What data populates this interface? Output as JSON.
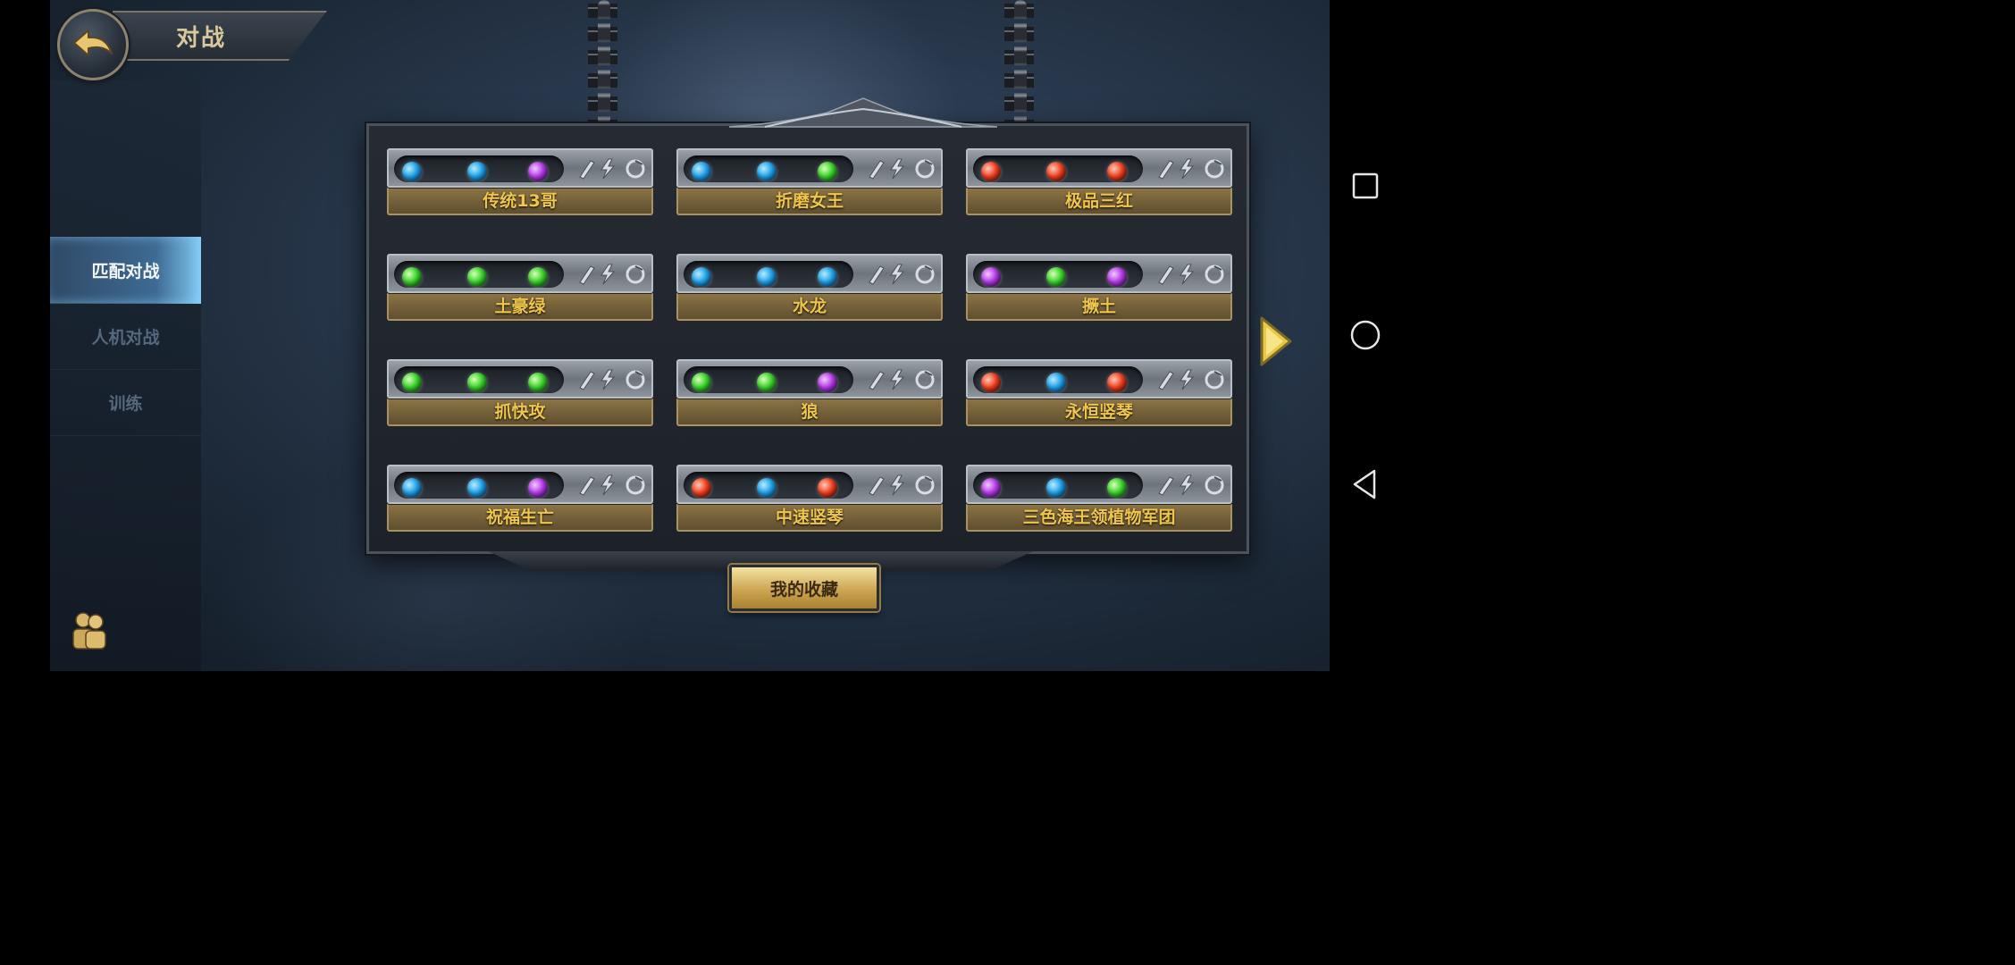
{
  "header": {
    "title": "对战",
    "back_icon": "back-arrow-icon"
  },
  "side_menu": {
    "items": [
      {
        "label": "匹配对战",
        "active": true
      },
      {
        "label": "人机对战",
        "active": false
      },
      {
        "label": "训练",
        "active": false
      }
    ],
    "friends_icon": "friends-icon"
  },
  "decks": [
    {
      "name": "传统13哥",
      "gems": [
        "blue",
        "blue",
        "purple"
      ]
    },
    {
      "name": "折磨女王",
      "gems": [
        "blue",
        "blue",
        "green"
      ]
    },
    {
      "name": "极品三红",
      "gems": [
        "red",
        "red",
        "red"
      ]
    },
    {
      "name": "土豪绿",
      "gems": [
        "green",
        "green",
        "green"
      ]
    },
    {
      "name": "水龙",
      "gems": [
        "blue",
        "blue",
        "blue"
      ]
    },
    {
      "name": "撅土",
      "gems": [
        "purple",
        "green",
        "purple"
      ]
    },
    {
      "name": "抓快攻",
      "gems": [
        "green",
        "green",
        "green"
      ]
    },
    {
      "name": "狼",
      "gems": [
        "green",
        "green",
        "purple"
      ]
    },
    {
      "name": "永恒竖琴",
      "gems": [
        "red",
        "blue",
        "red"
      ]
    },
    {
      "name": "祝福生亡",
      "gems": [
        "blue",
        "blue",
        "purple"
      ]
    },
    {
      "name": "中速竖琴",
      "gems": [
        "red",
        "blue",
        "red"
      ]
    },
    {
      "name": "三色海王领植物军团",
      "gems": [
        "purple",
        "blue",
        "green"
      ]
    }
  ],
  "favorites_button": {
    "label": "我的收藏"
  },
  "next_page_icon": "next-arrow-icon",
  "system_nav": {
    "recents_icon": "square-icon",
    "home_icon": "circle-icon",
    "back_icon": "triangle-back-icon"
  },
  "colors": {
    "gold_text": "#f0c64a",
    "title_text": "#d9c89d",
    "active_tab": "#3e6a93"
  }
}
